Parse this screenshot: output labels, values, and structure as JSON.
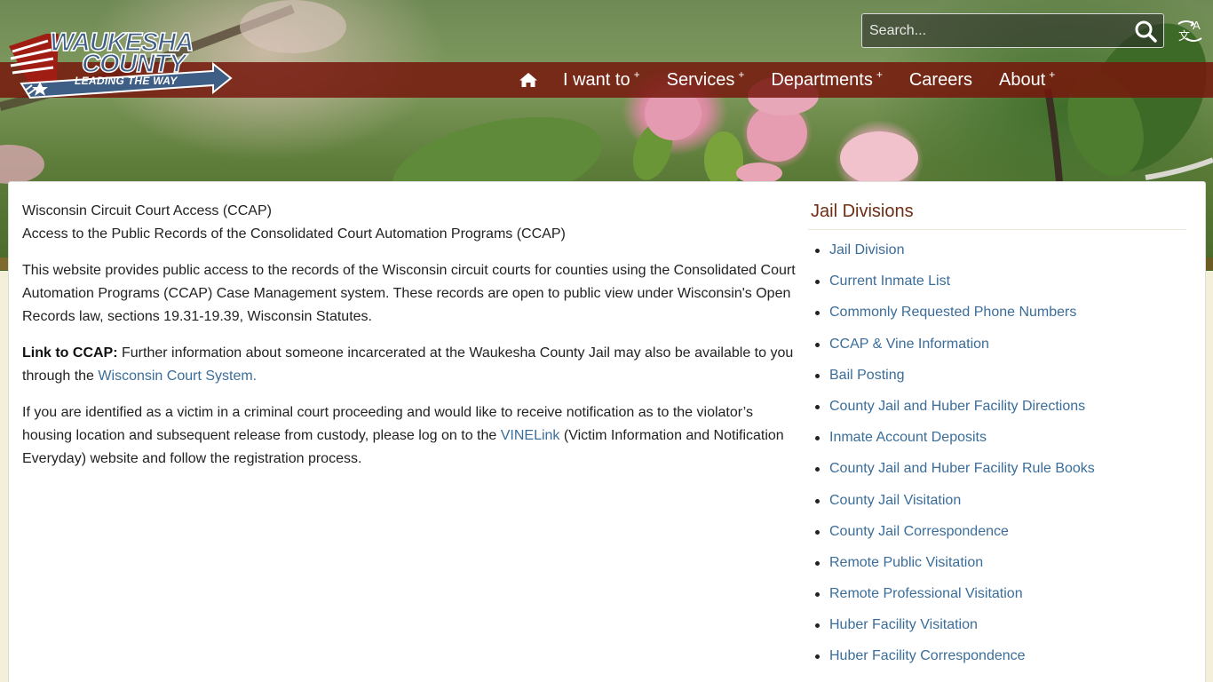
{
  "header": {
    "logo": {
      "line1": "WAUKESHA",
      "line2": "COUNTY",
      "tagline": "LEADING THE WAY"
    },
    "search": {
      "placeholder": "Search..."
    },
    "nav": [
      {
        "label": "I want to",
        "has_submenu": "+"
      },
      {
        "label": "Services",
        "has_submenu": "+"
      },
      {
        "label": "Departments",
        "has_submenu": "+"
      },
      {
        "label": "Careers",
        "has_submenu": ""
      },
      {
        "label": "About",
        "has_submenu": "+"
      }
    ]
  },
  "main": {
    "heading_line1": "Wisconsin Circuit Court Access (CCAP)",
    "heading_line2": "Access to the Public Records of the Consolidated Court Automation Programs (CCAP)",
    "para1": "This website provides public access to the records of the Wisconsin circuit courts for counties using the Consolidated Court Automation Programs (CCAP) Case Management system. These records are open to public view under Wisconsin's Open Records law, sections 19.31-19.39, Wisconsin Statutes.",
    "para2_label": "Link to CCAP:",
    "para2_text": " Further information about someone incarcerated at the Waukesha County Jail may also be available to you through the ",
    "para2_link": "Wisconsin Court System.",
    "para3_text_a": "If you are identified as a victim in a criminal court proceeding and would like to receive notification as to the violator’s housing location and subsequent release from custody, please log on to the ",
    "para3_link": "VINELink",
    "para3_text_b": " (Victim Information and Notification Everyday) website and follow the registration process."
  },
  "sidebar": {
    "title": "Jail Divisions",
    "items": [
      "Jail Division",
      "Current Inmate List",
      "Commonly Requested Phone Numbers",
      "CCAP & Vine Information",
      "Bail Posting",
      "County Jail and Huber Facility Directions",
      "Inmate Account Deposits",
      "County Jail and Huber Facility Rule Books",
      "County Jail Visitation",
      "County Jail Correspondence",
      "Remote Public Visitation",
      "Remote Professional Visitation",
      "Huber Facility Visitation",
      "Huber Facility Correspondence"
    ]
  },
  "colors": {
    "nav_bar": "#76160c",
    "link": "#3a6d9a",
    "sidebar_title": "#6e2c12",
    "logo_blue": "#3f5e86",
    "logo_red": "#a01d14"
  }
}
